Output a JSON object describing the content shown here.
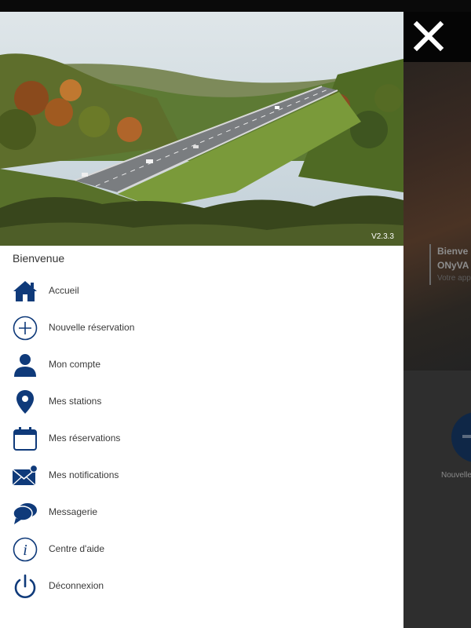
{
  "drawer": {
    "version": "V2.3.3",
    "welcome": "Bienvenue",
    "menu": [
      {
        "label": "Accueil",
        "icon": "home-icon"
      },
      {
        "label": "Nouvelle réservation",
        "icon": "plus-circle-icon"
      },
      {
        "label": "Mon compte",
        "icon": "user-icon"
      },
      {
        "label": "Mes stations",
        "icon": "location-pin-icon"
      },
      {
        "label": "Mes réservations",
        "icon": "calendar-icon"
      },
      {
        "label": "Mes notifications",
        "icon": "envelope-icon"
      },
      {
        "label": "Messagerie",
        "icon": "chat-bubbles-icon"
      },
      {
        "label": "Centre d'aide",
        "icon": "info-icon"
      },
      {
        "label": "Déconnexion",
        "icon": "power-icon"
      }
    ]
  },
  "background": {
    "hero_title_1": "Bienve",
    "hero_title_2": "ONyVA",
    "hero_subtitle": "Votre app",
    "fab_label": "Nouvelle"
  },
  "close_icon": "close-icon",
  "colors": {
    "icon": "#0f3a7a",
    "drawer_bg": "#ffffff"
  }
}
